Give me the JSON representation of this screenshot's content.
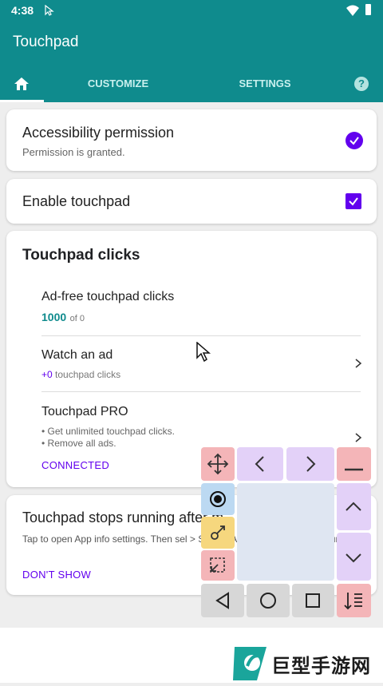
{
  "status_bar": {
    "time": "4:38"
  },
  "app": {
    "title": "Touchpad"
  },
  "tabs": [
    {
      "label": "",
      "icon": "home-icon"
    },
    {
      "label": "CUSTOMIZE"
    },
    {
      "label": "SETTINGS"
    },
    {
      "label": "?",
      "icon": "help-icon"
    }
  ],
  "accessibility": {
    "title": "Accessibility permission",
    "status": "Permission is granted."
  },
  "enable": {
    "label": "Enable touchpad"
  },
  "clicks": {
    "title": "Touchpad clicks",
    "adfree": {
      "label": "Ad-free touchpad clicks",
      "count": "1000",
      "of": "of 0"
    },
    "watch": {
      "label": "Watch an ad",
      "plus": "+0",
      "suffix": "touchpad clicks"
    },
    "pro": {
      "label": "Touchpad PRO",
      "line1": "• Get unlimited touchpad clicks.",
      "line2": "• Remove all ads.",
      "status": "CONNECTED"
    }
  },
  "stops": {
    "title": "Touchpad stops running after m",
    "text": "Tap to open App info settings. Then sel > Select \"All\" from drop down > Turn off t",
    "dont_show": "DON'T SHOW"
  },
  "watermark": {
    "text": "巨型手游网"
  },
  "colors": {
    "teal": "#0f8b8d",
    "purple": "#6200ee"
  }
}
